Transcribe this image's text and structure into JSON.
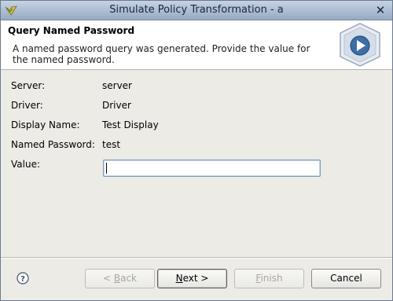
{
  "window": {
    "title": "Simulate Policy Transformation - a"
  },
  "banner": {
    "heading": "Query Named Password",
    "description": "A named password query was generated. Provide the value for the named password.",
    "icon": "wizard-play-icon"
  },
  "form": {
    "server_label": "Server:",
    "server_value": "server",
    "driver_label": "Driver:",
    "driver_value": "Driver",
    "display_name_label": "Display Name:",
    "display_name_value": "Test Display",
    "named_password_label": "Named Password:",
    "named_password_value": "test",
    "value_label": "Value:",
    "value_input": ""
  },
  "buttons": {
    "back": {
      "prefix": "< ",
      "mnemonic": "B",
      "rest": "ack"
    },
    "next": {
      "mnemonic": "N",
      "rest": "ext >"
    },
    "finish": {
      "mnemonic": "F",
      "rest": "inish"
    },
    "cancel": "Cancel"
  },
  "icons": {
    "app": "app-logo-icon",
    "close": "close-icon",
    "help": "help-icon"
  },
  "colors": {
    "titlebar": "#98aac2",
    "dialog_bg": "#ecebe6",
    "input_border": "#7f9db9"
  }
}
